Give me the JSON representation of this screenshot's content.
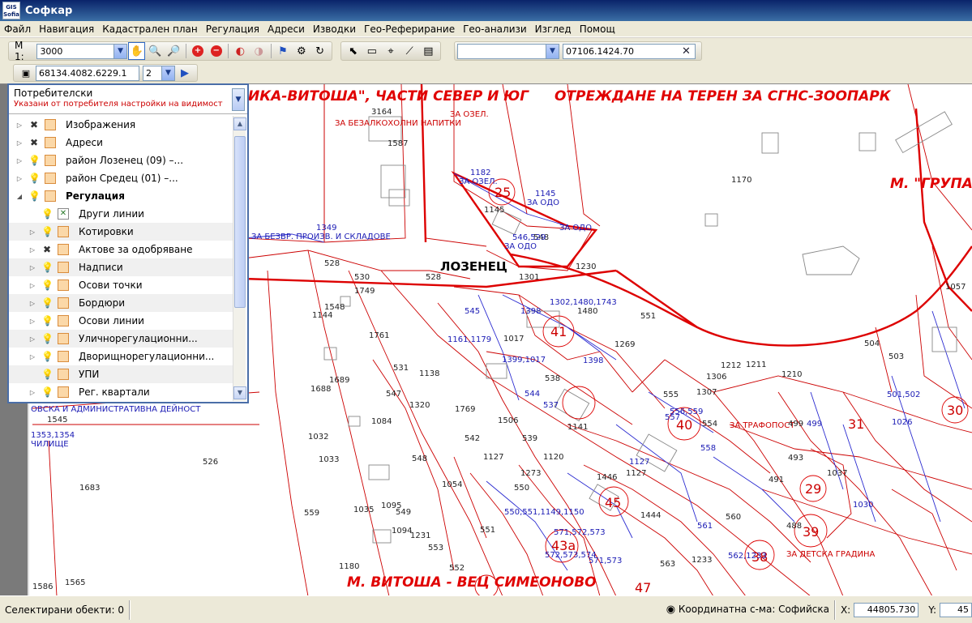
{
  "window": {
    "title": "Софкар",
    "logo": "GIS Sofia"
  },
  "menu": [
    "Файл",
    "Навигация",
    "Кадастрален план",
    "Регулация",
    "Адреси",
    "Изводки",
    "Гео-Реферирание",
    "Гео-анализи",
    "Изглед",
    "Помощ"
  ],
  "toolbar": {
    "scale_label": "M 1:",
    "scale_value": "3000",
    "layer_select_value": "",
    "search_value": "07106.1424.70",
    "object_id": "68134.4082.6229.1",
    "page_value": "2"
  },
  "layer_panel": {
    "title": "Потребителски",
    "subtitle": "Указани от потребителя настройки на видимост",
    "layers": [
      {
        "name": "Изображения",
        "bulb": "x",
        "expander": "▷"
      },
      {
        "name": "Адреси",
        "bulb": "x",
        "expander": "▷"
      },
      {
        "name": "район Лозенец (09) –...",
        "bulb": "on",
        "expander": "▷"
      },
      {
        "name": "район Средец (01) –...",
        "bulb": "on",
        "expander": "▷"
      },
      {
        "name": "Регулация",
        "bulb": "on",
        "expander": "◢",
        "bold": true
      },
      {
        "name": "Други линии",
        "bulb": "on",
        "expander": "",
        "child": true,
        "cross": true
      },
      {
        "name": "Котировки",
        "bulb": "off",
        "expander": "▷",
        "child": true
      },
      {
        "name": "Актове за одобряване",
        "bulb": "x",
        "expander": "▷",
        "child": true
      },
      {
        "name": "Надписи",
        "bulb": "off",
        "expander": "▷",
        "child": true
      },
      {
        "name": "Осови точки",
        "bulb": "off",
        "expander": "▷",
        "child": true
      },
      {
        "name": "Бордюри",
        "bulb": "off",
        "expander": "▷",
        "child": true
      },
      {
        "name": "Осови линии",
        "bulb": "off",
        "expander": "▷",
        "child": true
      },
      {
        "name": "Уличнорегулационни...",
        "bulb": "on",
        "expander": "▷",
        "child": true
      },
      {
        "name": "Дворищнорегулационни...",
        "bulb": "on",
        "expander": "▷",
        "child": true
      },
      {
        "name": "УПИ",
        "bulb": "on",
        "expander": "",
        "child": true
      },
      {
        "name": "Рег. квартали",
        "bulb": "on",
        "expander": "▷",
        "child": true
      }
    ]
  },
  "map": {
    "headers": [
      "ИКА-ВИТОША\", ЧАСТИ СЕВЕР И ЮГ",
      "ОТРЕЖДАНЕ НА ТЕРЕН ЗА СГНС-ЗООПАРК",
      "М. \"ГРУПА",
      "М. ВИТОША - ВЕЦ СИМЕОНОВО"
    ],
    "district": "ЛОЗЕНЕЦ",
    "labels": [
      {
        "t": "ЗА ОЗЕЛ.",
        "c": "red"
      },
      {
        "t": "ЗА БЕЗАЛКОХОЛНИ НАПИТКИ",
        "c": "red"
      },
      {
        "t": "ЗА ОЗЕЛ.",
        "c": "blue"
      },
      {
        "t": "ЗА ОДО",
        "c": "blue"
      },
      {
        "t": "ЗА ОДО",
        "c": "blue"
      },
      {
        "t": "ЗА ОДО",
        "c": "blue"
      },
      {
        "t": "ЗА БЕЗВР. ПРОИЗВ. И СКЛАДОВЕ",
        "c": "blue"
      },
      {
        "t": "ЗА ТРАФОПОСТ",
        "c": "red"
      },
      {
        "t": "ЗА ДЕТСКА ГРАДИНА",
        "c": "red"
      },
      {
        "t": "ОВСКА И АДМИНИСТРАТИВНА ДЕЙНОСТ",
        "c": "blue"
      },
      {
        "t": "ЧИЛИЩЕ",
        "c": "blue"
      },
      {
        "t": "1353,1354",
        "c": "blue"
      },
      {
        "t": "25",
        "c": "bigred"
      },
      {
        "t": "41",
        "c": "bigred"
      },
      {
        "t": "40",
        "c": "bigred"
      },
      {
        "t": "31",
        "c": "bigred"
      },
      {
        "t": "45",
        "c": "bigred"
      },
      {
        "t": "43а",
        "c": "bigred"
      },
      {
        "t": "39",
        "c": "bigred"
      },
      {
        "t": "38",
        "c": "bigred"
      },
      {
        "t": "29",
        "c": "bigred"
      },
      {
        "t": "47",
        "c": "bigred"
      },
      {
        "t": "30",
        "c": "bigred"
      },
      {
        "t": "3164",
        "c": "dark"
      },
      {
        "t": "1587",
        "c": "dark"
      },
      {
        "t": "1182",
        "c": "blue"
      },
      {
        "t": "1145",
        "c": "dark"
      },
      {
        "t": "1145",
        "c": "blue"
      },
      {
        "t": "1170",
        "c": "dark"
      },
      {
        "t": "1349",
        "c": "blue"
      },
      {
        "t": "528",
        "c": "dark"
      },
      {
        "t": "530",
        "c": "dark"
      },
      {
        "t": "528",
        "c": "dark"
      },
      {
        "t": "1749",
        "c": "dark"
      },
      {
        "t": "1548",
        "c": "dark"
      },
      {
        "t": "1144",
        "c": "dark"
      },
      {
        "t": "1761",
        "c": "dark"
      },
      {
        "t": "545",
        "c": "blue"
      },
      {
        "t": "1398",
        "c": "blue"
      },
      {
        "t": "1480",
        "c": "dark"
      },
      {
        "t": "1301",
        "c": "dark"
      },
      {
        "t": "1230",
        "c": "dark"
      },
      {
        "t": "548",
        "c": "dark"
      },
      {
        "t": "551",
        "c": "dark"
      },
      {
        "t": "1161,1179",
        "c": "blue"
      },
      {
        "t": "1017",
        "c": "dark"
      },
      {
        "t": "1399,1017",
        "c": "blue"
      },
      {
        "t": "1398",
        "c": "blue"
      },
      {
        "t": "1269",
        "c": "dark"
      },
      {
        "t": "504",
        "c": "dark"
      },
      {
        "t": "503",
        "c": "dark"
      },
      {
        "t": "1212",
        "c": "dark"
      },
      {
        "t": "1211",
        "c": "dark"
      },
      {
        "t": "1210",
        "c": "dark"
      },
      {
        "t": "1306",
        "c": "dark"
      },
      {
        "t": "1307",
        "c": "dark"
      },
      {
        "t": "531",
        "c": "dark"
      },
      {
        "t": "1138",
        "c": "dark"
      },
      {
        "t": "1689",
        "c": "dark"
      },
      {
        "t": "1688",
        "c": "dark"
      },
      {
        "t": "547",
        "c": "dark"
      },
      {
        "t": "1320",
        "c": "dark"
      },
      {
        "t": "1769",
        "c": "dark"
      },
      {
        "t": "1506",
        "c": "dark"
      },
      {
        "t": "1084",
        "c": "dark"
      },
      {
        "t": "1032",
        "c": "dark"
      },
      {
        "t": "542",
        "c": "dark"
      },
      {
        "t": "539",
        "c": "dark"
      },
      {
        "t": "1141",
        "c": "dark"
      },
      {
        "t": "1033",
        "c": "dark"
      },
      {
        "t": "548",
        "c": "dark"
      },
      {
        "t": "1127",
        "c": "dark"
      },
      {
        "t": "1120",
        "c": "dark"
      },
      {
        "t": "1273",
        "c": "dark"
      },
      {
        "t": "1127",
        "c": "blue"
      },
      {
        "t": "1127",
        "c": "dark"
      },
      {
        "t": "526",
        "c": "dark"
      },
      {
        "t": "1683",
        "c": "dark"
      },
      {
        "t": "1545",
        "c": "dark"
      },
      {
        "t": "559",
        "c": "dark"
      },
      {
        "t": "549",
        "c": "dark"
      },
      {
        "t": "1054",
        "c": "dark"
      },
      {
        "t": "550",
        "c": "dark"
      },
      {
        "t": "1035",
        "c": "dark"
      },
      {
        "t": "1095",
        "c": "dark"
      },
      {
        "t": "1094",
        "c": "dark"
      },
      {
        "t": "1231",
        "c": "dark"
      },
      {
        "t": "551",
        "c": "dark"
      },
      {
        "t": "553",
        "c": "dark"
      },
      {
        "t": "1180",
        "c": "dark"
      },
      {
        "t": "552",
        "c": "dark"
      },
      {
        "t": "1586",
        "c": "dark"
      },
      {
        "t": "1565",
        "c": "dark"
      },
      {
        "t": "550,551,1149,1150",
        "c": "blue"
      },
      {
        "t": "571,572,573",
        "c": "blue"
      },
      {
        "t": "572,573,574",
        "c": "blue"
      },
      {
        "t": "571,573",
        "c": "blue"
      },
      {
        "t": "1444",
        "c": "dark"
      },
      {
        "t": "1446",
        "c": "dark"
      },
      {
        "t": "560",
        "c": "dark"
      },
      {
        "t": "561",
        "c": "blue"
      },
      {
        "t": "562,1233",
        "c": "blue"
      },
      {
        "t": "1233",
        "c": "dark"
      },
      {
        "t": "563",
        "c": "dark"
      },
      {
        "t": "556,559",
        "c": "blue"
      },
      {
        "t": "557",
        "c": "blue"
      },
      {
        "t": "555",
        "c": "dark"
      },
      {
        "t": "558",
        "c": "blue"
      },
      {
        "t": "554",
        "c": "dark"
      },
      {
        "t": "499",
        "c": "dark"
      },
      {
        "t": "499",
        "c": "blue"
      },
      {
        "t": "493",
        "c": "dark"
      },
      {
        "t": "491",
        "c": "dark"
      },
      {
        "t": "488",
        "c": "dark"
      },
      {
        "t": "1037",
        "c": "dark"
      },
      {
        "t": "501,502",
        "c": "blue"
      },
      {
        "t": "1057",
        "c": "dark"
      },
      {
        "t": "1026",
        "c": "blue"
      },
      {
        "t": "1030",
        "c": "blue"
      },
      {
        "t": "538",
        "c": "dark"
      },
      {
        "t": "544",
        "c": "blue"
      },
      {
        "t": "537",
        "c": "blue"
      },
      {
        "t": "1302,1480,1743",
        "c": "blue"
      },
      {
        "t": "546,529",
        "c": "blue"
      }
    ]
  },
  "status": {
    "selected_label": "Селектирани обекти:",
    "selected_count": "0",
    "coord_system": "Координатна с-ма: Софийска",
    "x_label": "X:",
    "x_value": "44805.730",
    "y_label": "Y:",
    "y_value": "45"
  },
  "colors": {
    "title_bar": "#0a246a",
    "map_red": "#e00000",
    "map_blue": "#1a1ab4"
  }
}
